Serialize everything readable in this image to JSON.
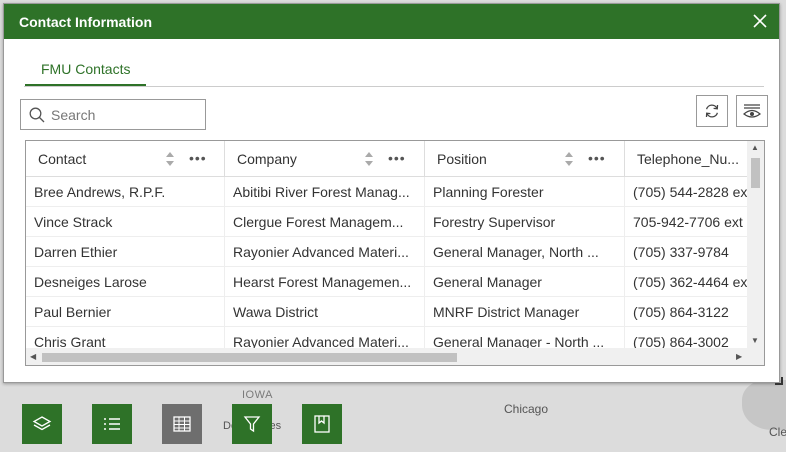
{
  "map": {
    "labels": {
      "iowa": "IOWA",
      "chicago": "Chicago",
      "desmoines": "Des Moines",
      "cleveland": "Cle"
    }
  },
  "dialog": {
    "title": "Contact Information",
    "tab": "FMU Contacts",
    "search_placeholder": "Search",
    "columns": [
      "Contact",
      "Company",
      "Position",
      "Telephone_Nu..."
    ],
    "rows": [
      [
        "Bree Andrews, R.P.F.",
        "Abitibi River Forest Manag...",
        "Planning Forester",
        "(705) 544-2828 ex"
      ],
      [
        "Vince Strack",
        "Clergue Forest Managem...",
        "Forestry Supervisor",
        "705-942-7706 ext"
      ],
      [
        "Darren Ethier",
        "Rayonier Advanced Materi...",
        "General Manager, North ...",
        "(705) 337-9784"
      ],
      [
        "Desneiges Larose",
        "Hearst Forest Managemen...",
        "General Manager",
        "(705) 362-4464 ex"
      ],
      [
        "Paul Bernier",
        "Wawa District",
        "MNRF District Manager",
        "(705) 864-3122"
      ],
      [
        "Chris Grant",
        "Rayonier Advanced Materi...",
        "General Manager - North ...",
        "(705) 864-3002"
      ]
    ]
  },
  "toolbar": {
    "buttons": [
      {
        "icon": "layers-icon",
        "color": "#2e7228"
      },
      {
        "icon": "legend-list-icon",
        "color": "#2e7228"
      },
      {
        "icon": "table-icon",
        "color": "#6e6e6e"
      },
      {
        "icon": "filter-icon",
        "color": "#2e7228"
      },
      {
        "icon": "bookmark-icon",
        "color": "#2e7228"
      }
    ]
  },
  "colors": {
    "accent": "#2e7228",
    "header_bg": "#2e7228"
  }
}
